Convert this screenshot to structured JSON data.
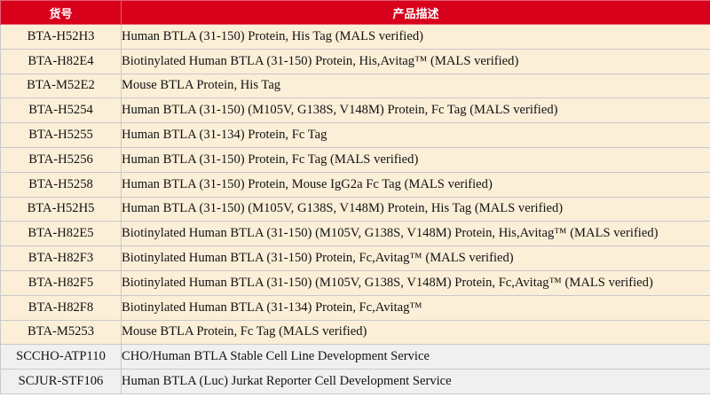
{
  "header": {
    "code": "货号",
    "description": "产品描述"
  },
  "rows": [
    {
      "code": "BTA-H52H3",
      "description": "Human BTLA (31-150) Protein, His Tag (MALS verified)"
    },
    {
      "code": "BTA-H82E4",
      "description": "Biotinylated Human BTLA (31-150) Protein, His,Avitag™ (MALS verified)"
    },
    {
      "code": "BTA-M52E2",
      "description": "Mouse BTLA Protein, His Tag"
    },
    {
      "code": "BTA-H5254",
      "description": "Human BTLA (31-150) (M105V, G138S, V148M) Protein, Fc Tag (MALS verified)"
    },
    {
      "code": "BTA-H5255",
      "description": "Human BTLA (31-134) Protein, Fc Tag"
    },
    {
      "code": "BTA-H5256",
      "description": "Human BTLA (31-150) Protein, Fc Tag (MALS verified)"
    },
    {
      "code": "BTA-H5258",
      "description": "Human BTLA (31-150) Protein, Mouse IgG2a Fc Tag (MALS verified)"
    },
    {
      "code": "BTA-H52H5",
      "description": "Human BTLA (31-150) (M105V, G138S, V148M) Protein, His Tag (MALS verified)"
    },
    {
      "code": "BTA-H82E5",
      "description": "Biotinylated Human BTLA (31-150) (M105V, G138S, V148M) Protein, His,Avitag™ (MALS verified)"
    },
    {
      "code": "BTA-H82F3",
      "description": "Biotinylated Human BTLA (31-150) Protein, Fc,Avitag™ (MALS verified)"
    },
    {
      "code": "BTA-H82F5",
      "description": "Biotinylated Human BTLA (31-150) (M105V, G138S, V148M) Protein, Fc,Avitag™ (MALS verified)"
    },
    {
      "code": "BTA-H82F8",
      "description": "Biotinylated Human BTLA (31-134) Protein, Fc,Avitag™"
    },
    {
      "code": "BTA-M5253",
      "description": "Mouse BTLA Protein, Fc Tag (MALS verified)"
    },
    {
      "code": "SCCHO-ATP110",
      "description": "CHO/Human BTLA Stable Cell Line Development Service"
    },
    {
      "code": "SCJUR-STF106",
      "description": "Human BTLA (Luc) Jurkat Reporter Cell Development Service"
    }
  ],
  "colors": {
    "header_bg": "#d9001b",
    "header_text": "#ffffff",
    "row_bg": "#fcefd8",
    "service_row_bg": "#f0f0f0",
    "border": "#c9c9c9"
  }
}
